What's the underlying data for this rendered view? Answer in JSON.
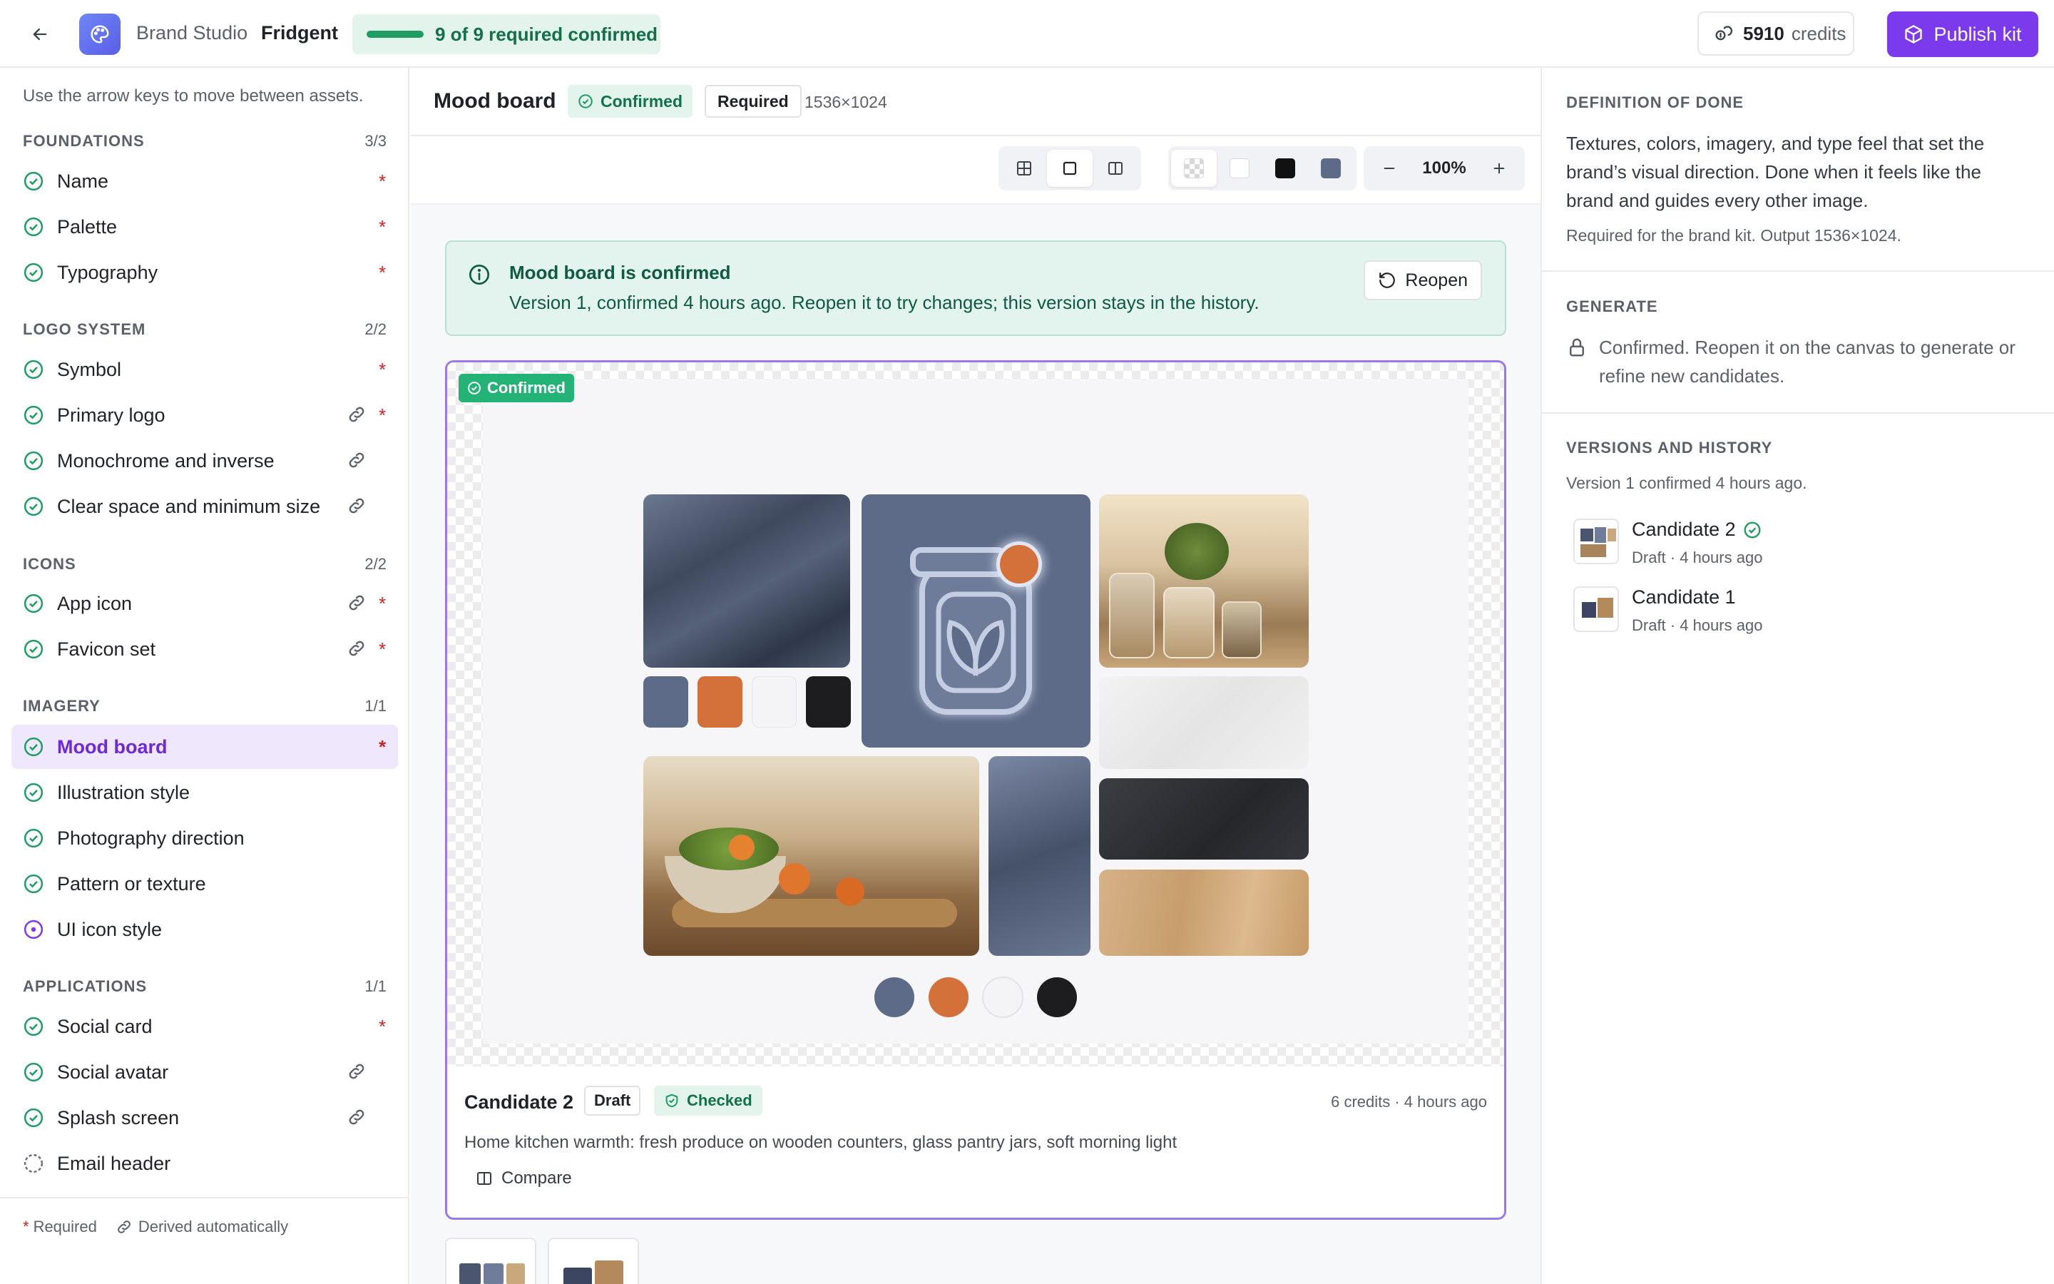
{
  "header": {
    "studio": "Brand Studio",
    "brand": "Fridgent",
    "progress_label": "9 of 9 required confirmed",
    "progress_fraction": 1.0,
    "credits_value": "5910",
    "credits_label": "credits",
    "publish_label": "Publish kit"
  },
  "sidebar": {
    "hint": "Use the arrow keys to move between assets.",
    "sections": [
      {
        "title": "FOUNDATIONS",
        "count": "3/3"
      },
      {
        "title": "LOGO SYSTEM",
        "count": "2/2"
      },
      {
        "title": "ICONS",
        "count": "2/2"
      },
      {
        "title": "IMAGERY",
        "count": "1/1"
      },
      {
        "title": "APPLICATIONS",
        "count": "1/1"
      }
    ],
    "items": [
      {
        "label": "Name",
        "status": "confirmed",
        "required": true,
        "derived": false
      },
      {
        "label": "Palette",
        "status": "confirmed",
        "required": true,
        "derived": false
      },
      {
        "label": "Typography",
        "status": "confirmed",
        "required": true,
        "derived": false
      },
      {
        "label": "Symbol",
        "status": "confirmed",
        "required": true,
        "derived": false
      },
      {
        "label": "Primary logo",
        "status": "confirmed",
        "required": true,
        "derived": true
      },
      {
        "label": "Monochrome and inverse",
        "status": "confirmed",
        "required": false,
        "derived": true
      },
      {
        "label": "Clear space and minimum size",
        "status": "confirmed",
        "required": false,
        "derived": true
      },
      {
        "label": "App icon",
        "status": "confirmed",
        "required": true,
        "derived": true
      },
      {
        "label": "Favicon set",
        "status": "confirmed",
        "required": true,
        "derived": true
      },
      {
        "label": "Mood board",
        "status": "confirmed",
        "required": true,
        "derived": false
      },
      {
        "label": "Illustration style",
        "status": "confirmed",
        "required": false,
        "derived": false
      },
      {
        "label": "Photography direction",
        "status": "confirmed",
        "required": false,
        "derived": false
      },
      {
        "label": "Pattern or texture",
        "status": "confirmed",
        "required": false,
        "derived": false
      },
      {
        "label": "UI icon style",
        "status": "in-progress",
        "required": false,
        "derived": false
      },
      {
        "label": "Social card",
        "status": "confirmed",
        "required": true,
        "derived": false
      },
      {
        "label": "Social avatar",
        "status": "confirmed",
        "required": false,
        "derived": true
      },
      {
        "label": "Splash screen",
        "status": "confirmed",
        "required": false,
        "derived": true
      },
      {
        "label": "Email header",
        "status": "pending",
        "required": false,
        "derived": false
      }
    ],
    "legend_required_star": "*",
    "legend_required": "Required",
    "legend_derived": "Derived automatically"
  },
  "main": {
    "title": "Mood board",
    "status_badge": "Confirmed",
    "required_badge": "Required",
    "dimensions": "1536×1024",
    "zoom": "100%",
    "background_swatches": [
      "#ffffff",
      "#111111",
      "#5d6b88"
    ],
    "banner": {
      "title": "Mood board is confirmed",
      "text": "Version 1, confirmed 4 hours ago. Reopen it to try changes; this version stays in the history.",
      "reopen_label": "Reopen"
    },
    "card": {
      "badge": "Confirmed",
      "name": "Candidate 2",
      "draft_badge": "Draft",
      "checked_badge": "Checked",
      "meta": "6 credits · 4 hours ago",
      "description": "Home kitchen warmth: fresh produce on wooden counters, glass pantry jars, soft morning light",
      "compare_label": "Compare",
      "palette_colors": [
        "#5d6b88",
        "#d4703a",
        "#f4f4f6",
        "#1d1d1f"
      ]
    }
  },
  "right_panel": {
    "dod_heading": "DEFINITION OF DONE",
    "dod_text": "Textures, colors, imagery, and type feel that set the brand’s visual direction. Done when it feels like the brand and guides every other image.",
    "dod_sub": "Required for the brand kit. Output 1536×1024.",
    "generate_heading": "GENERATE",
    "generate_text": "Confirmed. Reopen it on the canvas to generate or refine new candidates.",
    "versions_heading": "VERSIONS AND HISTORY",
    "versions_sub": "Version 1 confirmed 4 hours ago.",
    "versions": [
      {
        "name": "Candidate 2",
        "meta": "Draft · 4 hours ago",
        "confirmed": true
      },
      {
        "name": "Candidate 1",
        "meta": "Draft · 4 hours ago",
        "confirmed": false
      }
    ]
  },
  "colors": {
    "accent": "#7c3aed",
    "success": "#1f9d63",
    "required": "#c62828"
  }
}
